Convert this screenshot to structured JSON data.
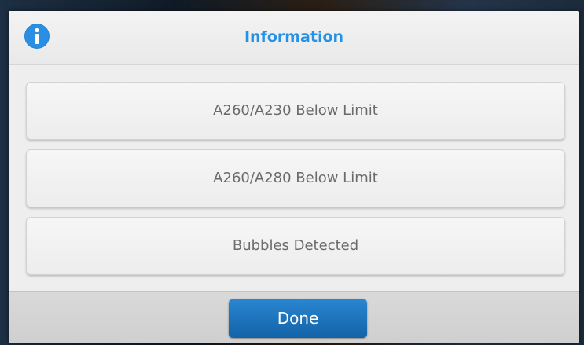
{
  "dialog": {
    "title": "Information",
    "icon": "info-icon",
    "accent_color": "#2391e6",
    "items": [
      {
        "label": "A260/A230 Below Limit"
      },
      {
        "label": "A260/A280 Below Limit"
      },
      {
        "label": "Bubbles Detected"
      }
    ],
    "done_label": "Done",
    "done_color": "#1e74bf"
  }
}
